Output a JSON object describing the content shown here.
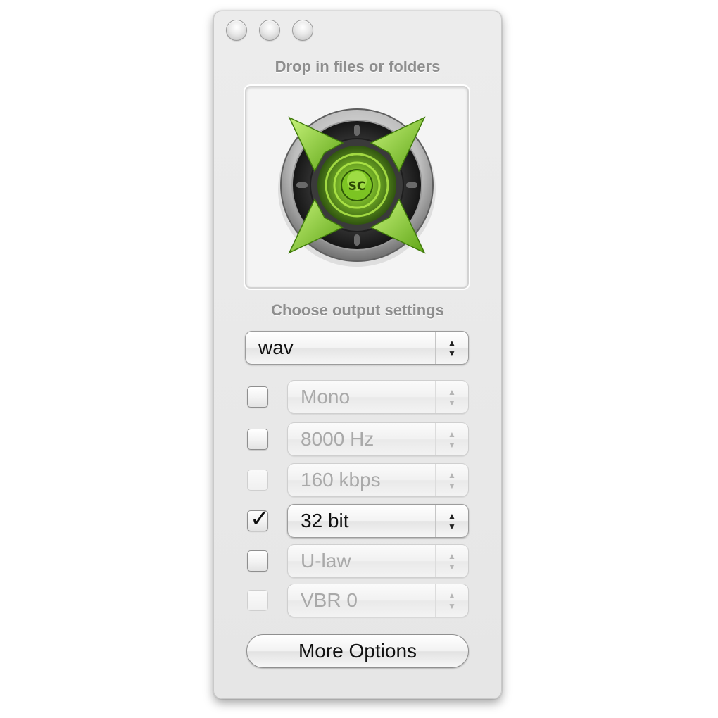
{
  "window": {
    "drop_label": "Drop in files or folders",
    "output_label": "Choose output settings"
  },
  "format_select": {
    "value": "wav"
  },
  "options": [
    {
      "value": "Mono",
      "checked": false,
      "enabled": false,
      "checkbox_enabled": true
    },
    {
      "value": "8000 Hz",
      "checked": false,
      "enabled": false,
      "checkbox_enabled": true
    },
    {
      "value": "160 kbps",
      "checked": false,
      "enabled": false,
      "checkbox_enabled": false
    },
    {
      "value": "32 bit",
      "checked": true,
      "enabled": true,
      "checkbox_enabled": true
    },
    {
      "value": "U-law",
      "checked": false,
      "enabled": false,
      "checkbox_enabled": true
    },
    {
      "value": "VBR 0",
      "checked": false,
      "enabled": false,
      "checkbox_enabled": false
    }
  ],
  "more_options_label": "More Options",
  "icons": {
    "drop_target": "speaker-arrows-icon",
    "select_arrows": "up-down-arrows-icon",
    "checkmark": "checkmark-icon"
  },
  "logo_text": "SC",
  "colors": {
    "accent_green": "#8fd13a",
    "label_gray": "#8e8e8e"
  }
}
